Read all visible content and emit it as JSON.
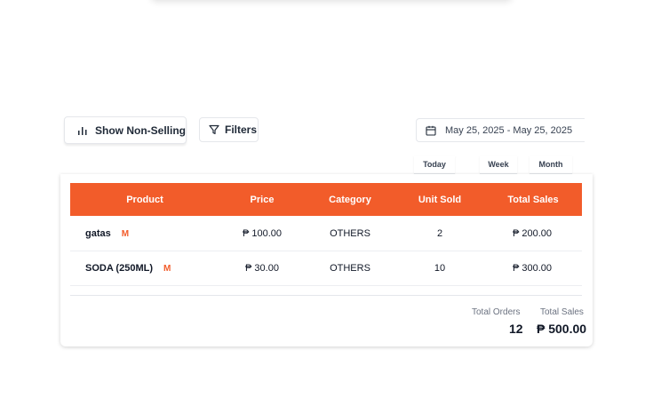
{
  "toolbar": {
    "show_non_selling_label": "Show Non-Selling",
    "filters_label": "Filters"
  },
  "date_range": {
    "value": "May 25, 2025 - May 25, 2025"
  },
  "period": {
    "today": "Today",
    "week": "Week",
    "month": "Month"
  },
  "table": {
    "headers": [
      "Product",
      "Price",
      "Category",
      "Unit Sold",
      "Total Sales"
    ],
    "rows": [
      {
        "product": "gatas",
        "badge": "M",
        "price": "₱ 100.00",
        "category": "OTHERS",
        "unit_sold": "2",
        "total_sales": "₱ 200.00"
      },
      {
        "product": "SODA (250ML)",
        "badge": "M",
        "price": "₱ 30.00",
        "category": "OTHERS",
        "unit_sold": "10",
        "total_sales": "₱ 300.00"
      }
    ]
  },
  "summary": {
    "total_orders_label": "Total Orders",
    "total_orders_value": "12",
    "total_sales_label": "Total Sales",
    "total_sales_value": "₱ 500.00"
  },
  "colors": {
    "accent": "#f25c2a"
  }
}
